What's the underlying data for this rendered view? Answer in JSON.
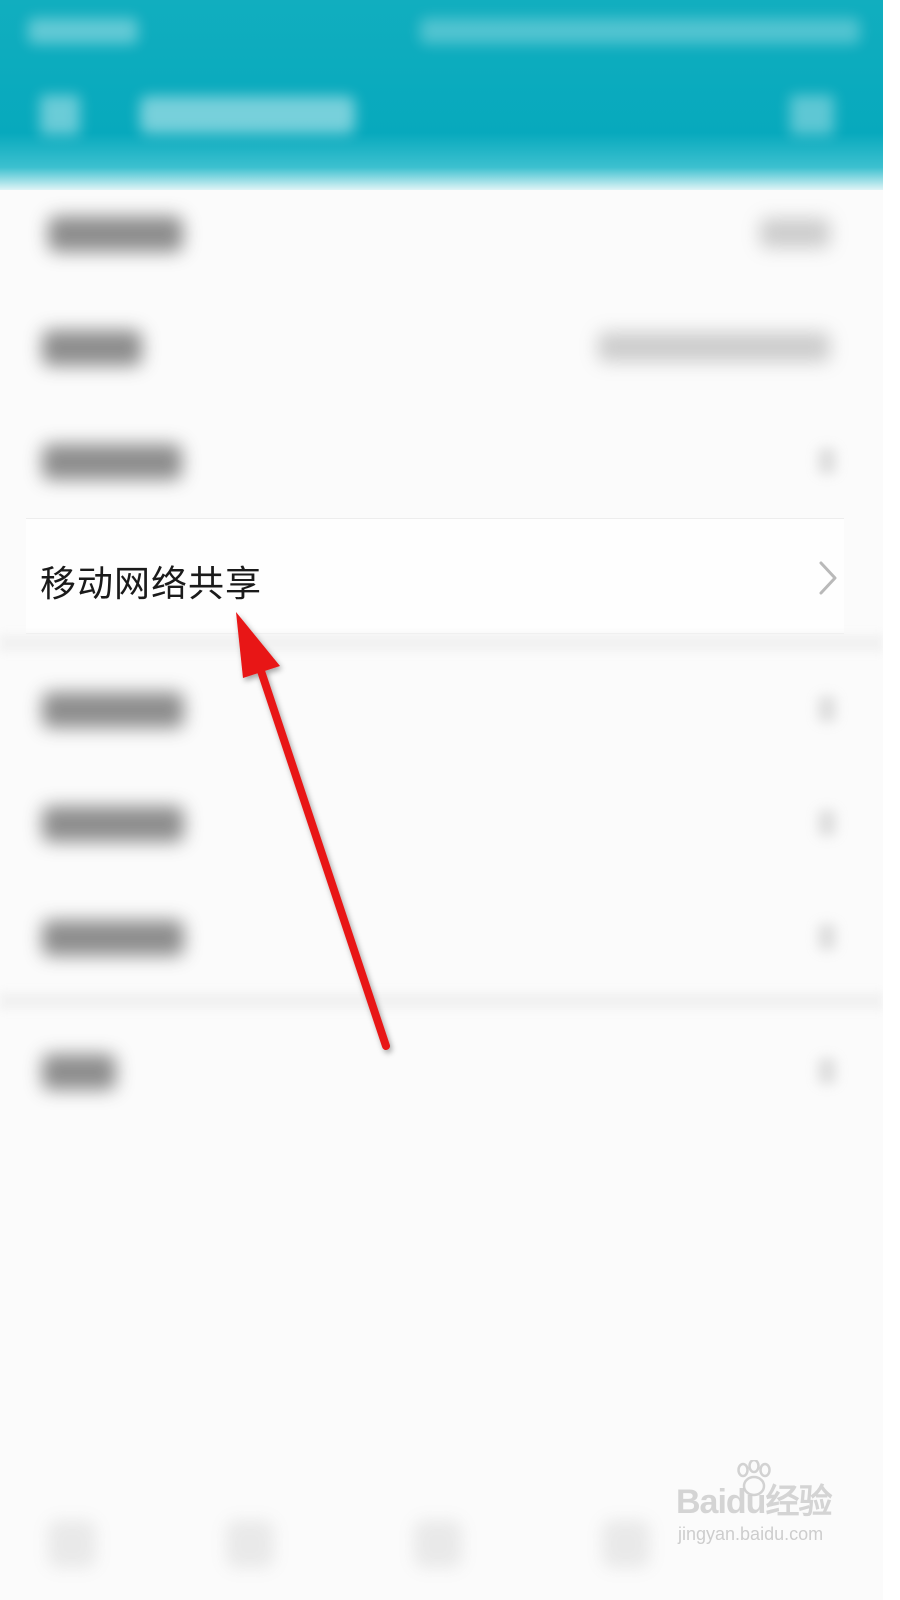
{
  "list": {
    "focused_item_label": "移动网络共享"
  },
  "watermark": {
    "brand": "Baidu经验",
    "url": "jingyan.baidu.com"
  },
  "colors": {
    "header": "#07a9bd",
    "arrow": "#e81414"
  },
  "icons": {
    "focused_chevron": "chevron-right-icon",
    "annotation": "red-arrow"
  }
}
